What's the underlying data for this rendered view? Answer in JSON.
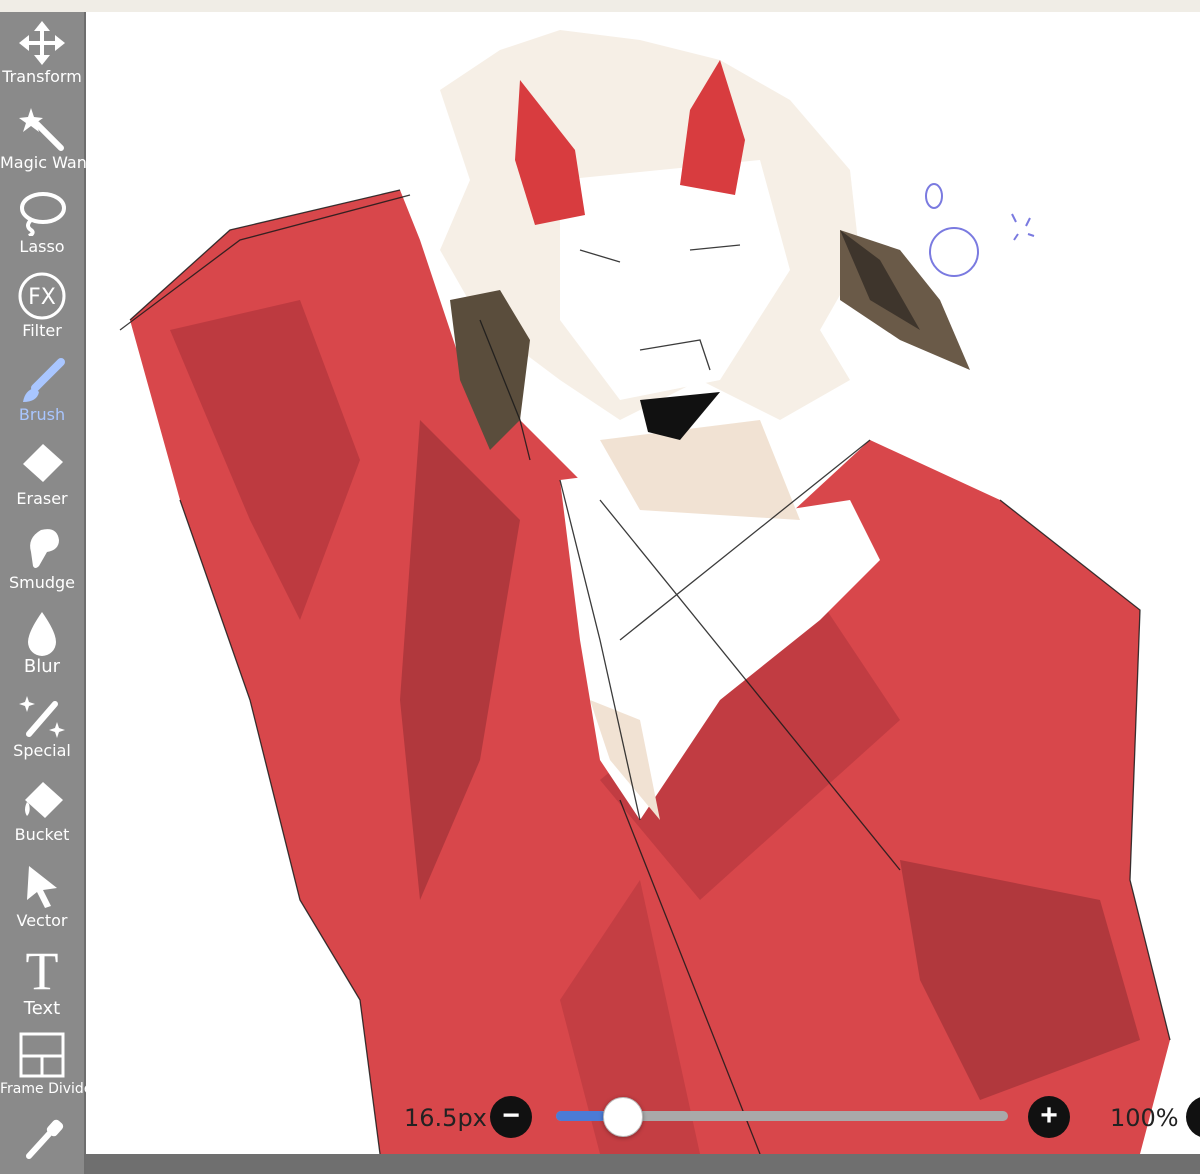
{
  "toolbar": {
    "tools": [
      {
        "label": "Transform",
        "icon": "move-arrows-icon"
      },
      {
        "label": "Magic Wand",
        "icon": "magic-wand-icon"
      },
      {
        "label": "Lasso",
        "icon": "lasso-icon"
      },
      {
        "label": "Filter",
        "icon": "fx-filter-icon",
        "badge": "FX"
      },
      {
        "label": "Brush",
        "icon": "brush-icon",
        "active": true
      },
      {
        "label": "Eraser",
        "icon": "eraser-icon"
      },
      {
        "label": "Smudge",
        "icon": "smudge-icon"
      },
      {
        "label": "Blur",
        "icon": "blur-drop-icon"
      },
      {
        "label": "Special",
        "icon": "special-sparkle-pen-icon"
      },
      {
        "label": "Bucket",
        "icon": "bucket-icon"
      },
      {
        "label": "Vector",
        "icon": "vector-cursor-icon"
      },
      {
        "label": "Text",
        "icon": "text-icon",
        "glyph": "T"
      },
      {
        "label": "Frame Divider",
        "icon": "frame-divider-icon"
      },
      {
        "label": "",
        "icon": "eyedropper-icon"
      }
    ],
    "active_color": "#a9c6ff"
  },
  "brush_controls": {
    "size_text": "16.5px",
    "minus": "−",
    "plus": "+",
    "size_fraction": 0.11,
    "zoom_text": "100%"
  },
  "colors": {
    "sidebar_bg": "#8a8a8a",
    "canvas_bg": "#ffffff",
    "slider_fill": "#4b7bd6",
    "coat_red": "#d8474b",
    "coat_dark": "#a8343a"
  }
}
